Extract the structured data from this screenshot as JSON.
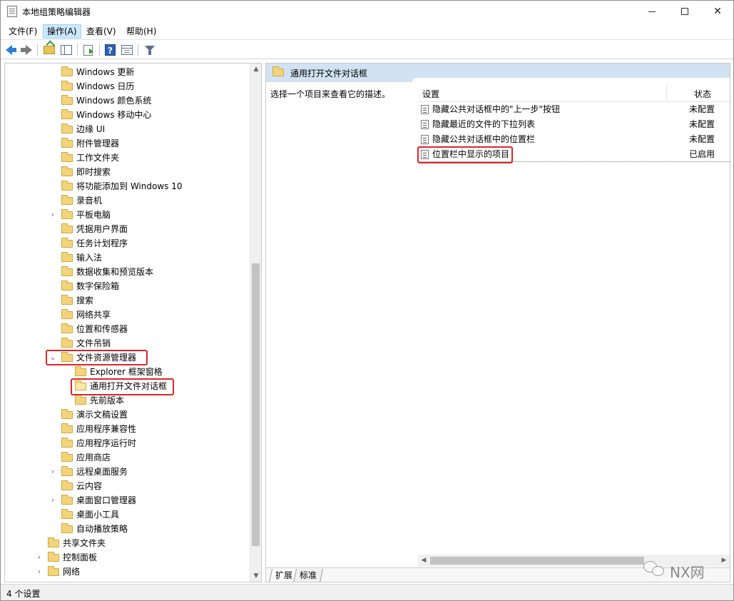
{
  "window": {
    "title": "本地组策略编辑器",
    "minimize_icon": "minimize-icon",
    "maximize_icon": "maximize-icon",
    "close_icon": "close-icon",
    "close_glyph": "✕"
  },
  "menu": {
    "items": [
      {
        "label": "文件(F)"
      },
      {
        "label": "操作(A)"
      },
      {
        "label": "查看(V)"
      },
      {
        "label": "帮助(H)"
      }
    ]
  },
  "toolbar": {
    "icons": [
      "back-arrow-icon",
      "forward-arrow-icon",
      "up-folder-icon",
      "show-hide-tree-icon",
      "export-list-icon",
      "help-icon",
      "properties-icon",
      "filter-icon"
    ],
    "help_glyph": "?"
  },
  "tree": {
    "items": [
      {
        "label": "Windows 更新",
        "expander": ""
      },
      {
        "label": "Windows 日历",
        "expander": ""
      },
      {
        "label": "Windows 颜色系统",
        "expander": ""
      },
      {
        "label": "Windows 移动中心",
        "expander": ""
      },
      {
        "label": "边缘 UI",
        "expander": ""
      },
      {
        "label": "附件管理器",
        "expander": ""
      },
      {
        "label": "工作文件夹",
        "expander": ""
      },
      {
        "label": "即时搜索",
        "expander": ""
      },
      {
        "label": "将功能添加到 Windows 10",
        "expander": ""
      },
      {
        "label": "录音机",
        "expander": ""
      },
      {
        "label": "平板电脑",
        "expander": "›"
      },
      {
        "label": "凭据用户界面",
        "expander": ""
      },
      {
        "label": "任务计划程序",
        "expander": ""
      },
      {
        "label": "输入法",
        "expander": ""
      },
      {
        "label": "数据收集和预览版本",
        "expander": ""
      },
      {
        "label": "数字保险箱",
        "expander": ""
      },
      {
        "label": "搜索",
        "expander": ""
      },
      {
        "label": "网络共享",
        "expander": ""
      },
      {
        "label": "位置和传感器",
        "expander": ""
      },
      {
        "label": "文件吊销",
        "expander": ""
      },
      {
        "label": "文件资源管理器",
        "expander": "⌄"
      },
      {
        "label": "Explorer 框架窗格",
        "expander": ""
      },
      {
        "label": "通用打开文件对话框",
        "expander": ""
      },
      {
        "label": "先前版本",
        "expander": ""
      },
      {
        "label": "演示文稿设置",
        "expander": ""
      },
      {
        "label": "应用程序兼容性",
        "expander": ""
      },
      {
        "label": "应用程序运行时",
        "expander": ""
      },
      {
        "label": "应用商店",
        "expander": ""
      },
      {
        "label": "远程桌面服务",
        "expander": "›"
      },
      {
        "label": "云内容",
        "expander": ""
      },
      {
        "label": "桌面窗口管理器",
        "expander": "›"
      },
      {
        "label": "桌面小工具",
        "expander": ""
      },
      {
        "label": "自动播放策略",
        "expander": ""
      },
      {
        "label": "共享文件夹",
        "expander": ""
      },
      {
        "label": "控制面板",
        "expander": "›"
      },
      {
        "label": "网络",
        "expander": "›"
      }
    ],
    "scroll_up": "▲",
    "scroll_down": "▼"
  },
  "details": {
    "header_title": "通用打开文件对话框",
    "description": "选择一个项目来查看它的描述。",
    "columns": {
      "setting": "设置",
      "state": "状态"
    },
    "rows": [
      {
        "name": "隐藏公共对话框中的\"上一步\"按钮",
        "state": "未配置"
      },
      {
        "name": "隐藏最近的文件的下拉列表",
        "state": "未配置"
      },
      {
        "name": "隐藏公共对话框中的位置栏",
        "state": "未配置"
      },
      {
        "name": "位置栏中显示的项目",
        "state": "已启用"
      }
    ],
    "scroll_left": "◀",
    "scroll_right": "▶",
    "tabs": [
      {
        "label": "扩展"
      },
      {
        "label": "标准"
      }
    ]
  },
  "status": {
    "text": "4 个设置"
  },
  "watermark": {
    "text": "NX网"
  },
  "colors": {
    "highlight_border": "#d9262b",
    "details_header_bg": "#d2e2f3",
    "menu_active_bg": "#cce8ff"
  }
}
